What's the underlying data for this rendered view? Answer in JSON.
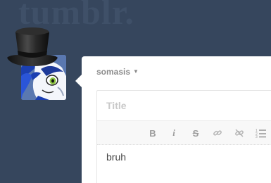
{
  "brand": {
    "logo_text": "tumblr."
  },
  "composer": {
    "blog_name": "somasis",
    "title_placeholder": "Title",
    "body_text": "bruh"
  },
  "toolbar": {
    "bold_label": "B",
    "italic_label": "i",
    "strike_label": "S",
    "buttons": [
      "bold-icon",
      "italic-icon",
      "strikethrough-icon",
      "link-icon",
      "unlink-icon",
      "ordered-list-icon"
    ]
  },
  "colors": {
    "background": "#36465d",
    "panel": "#ffffff",
    "muted_text": "#8a8a8a",
    "toolbar_icon": "#9c9c9c"
  }
}
